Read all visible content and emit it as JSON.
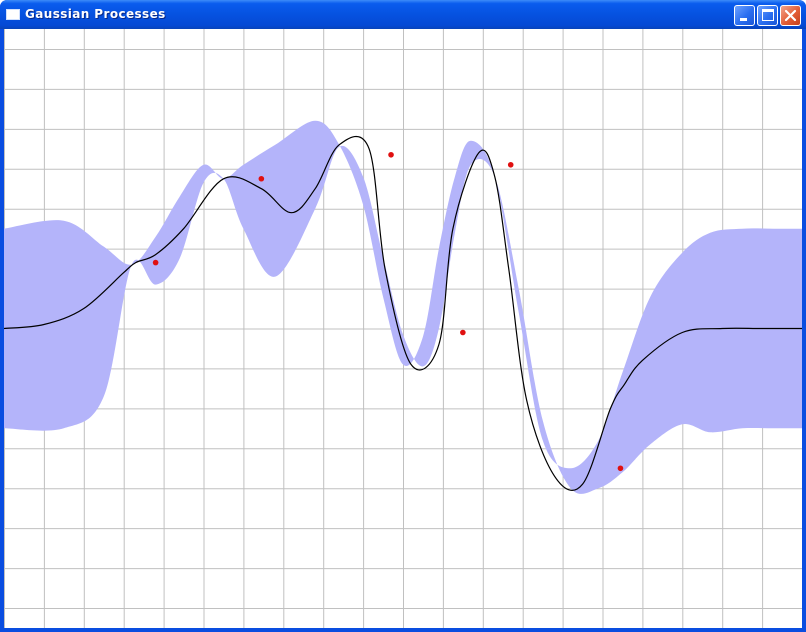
{
  "window": {
    "title": "Gaussian Processes",
    "title_icon": "window-icon",
    "controls": [
      {
        "name": "minimize",
        "icon": "minimize-icon"
      },
      {
        "name": "maximize",
        "icon": "maximize-icon"
      },
      {
        "name": "close",
        "icon": "close-icon"
      }
    ]
  },
  "colors": {
    "titlebar": "#0652e0",
    "grid": "#c0c0c0",
    "band": "#b4b4fa",
    "mean_line": "#000000",
    "points": "#e01010",
    "close_button": "#e35d36"
  },
  "chart_data": {
    "type": "line",
    "grid": true,
    "xlim": [
      0,
      20
    ],
    "ylim": [
      -7.5,
      7.5
    ],
    "mean": {
      "x": [
        0,
        1,
        2,
        3,
        3.3,
        3.8,
        4.5,
        5.5,
        6.45,
        7.2,
        7.8,
        8.4,
        9.15,
        9.55,
        10.2,
        10.9,
        11.25,
        11.9,
        12.3,
        12.65,
        13.1,
        13.8,
        14.5,
        15.2,
        15.55,
        16,
        17,
        18,
        19,
        20
      ],
      "y": [
        0,
        0.1,
        0.5,
        1.4,
        1.65,
        1.85,
        2.5,
        3.75,
        3.5,
        2.9,
        3.5,
        4.6,
        4.5,
        1.5,
        -0.9,
        -0.4,
        2.5,
        4.4,
        3.8,
        1.5,
        -1.8,
        -3.7,
        -3.9,
        -2.0,
        -1.4,
        -0.8,
        -0.1,
        0,
        0,
        0
      ]
    },
    "band": {
      "x": [
        0,
        1.5,
        2.5,
        3.2,
        3.8,
        4.4,
        5.0,
        5.5,
        6.0,
        6.8,
        7.8,
        8.4,
        9.0,
        9.5,
        10.0,
        10.5,
        10.9,
        11.3,
        11.7,
        12.3,
        12.9,
        13.5,
        14.2,
        14.9,
        15.5,
        16.2,
        17.0,
        17.7,
        18.5,
        19.3,
        20
      ],
      "upper": [
        2.5,
        2.7,
        2.05,
        1.6,
        2.3,
        3.3,
        4.1,
        3.75,
        4.1,
        4.6,
        5.2,
        4.6,
        3.1,
        0.8,
        -0.9,
        -0.2,
        2.0,
        3.8,
        4.7,
        3.8,
        0.4,
        -2.8,
        -3.5,
        -2.8,
        -1.1,
        0.8,
        1.9,
        2.4,
        2.5,
        2.5,
        2.5
      ],
      "lower": [
        -2.5,
        -2.5,
        -1.7,
        1.6,
        1.1,
        1.75,
        3.65,
        3.75,
        2.5,
        1.3,
        3.0,
        4.55,
        3.8,
        1.8,
        -0.15,
        -0.95,
        0.0,
        2.4,
        4.1,
        3.8,
        1.0,
        -2.3,
        -4.0,
        -4.0,
        -3.6,
        -2.9,
        -2.4,
        -2.6,
        -2.5,
        -2.5,
        -2.5
      ]
    },
    "points": {
      "x": [
        3.8,
        6.45,
        9.7,
        11.5,
        12.7,
        15.45
      ],
      "y": [
        1.65,
        3.75,
        4.35,
        -0.1,
        4.1,
        -3.5
      ]
    }
  }
}
